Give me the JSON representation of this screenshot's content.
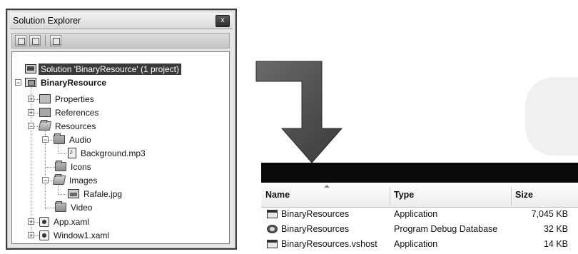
{
  "solution_explorer": {
    "title": "Solution Explorer",
    "close_glyph": "x",
    "tree": {
      "solution": "Solution 'BinaryResource' (1 project)",
      "project": "BinaryResource",
      "properties": "Properties",
      "references": "References",
      "resources": "Resources",
      "audio": "Audio",
      "background": "Background.mp3",
      "icons": "Icons",
      "images": "Images",
      "rafale": "Rafale.jpg",
      "video": "Video",
      "app_xaml": "App.xaml",
      "window1_xaml": "Window1.xaml"
    }
  },
  "file_list": {
    "columns": {
      "name": "Name",
      "type": "Type",
      "size": "Size"
    },
    "rows": [
      {
        "name": "BinaryResources",
        "type": "Application",
        "size": "7,045 KB",
        "icon": "application-icon"
      },
      {
        "name": "BinaryResources",
        "type": "Program Debug Database",
        "size": "32 KB",
        "icon": "debug-database-icon"
      },
      {
        "name": "BinaryResources.vshost",
        "type": "Application",
        "size": "14 KB",
        "icon": "application-icon"
      }
    ]
  },
  "colors": {
    "arrow": "#4a4a4a",
    "selection": "#3a3a3a",
    "header_bar": "#0a0a0a"
  }
}
